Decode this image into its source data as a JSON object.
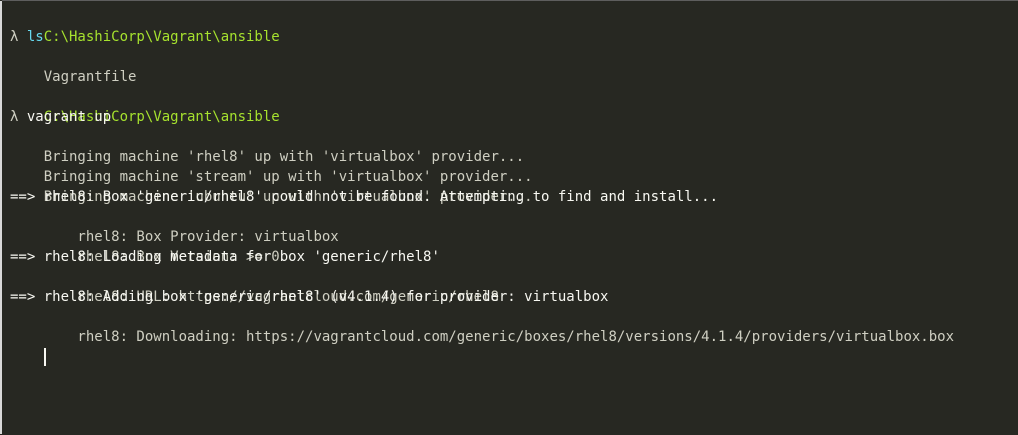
{
  "window": {
    "lines": [
      {
        "kind": "path",
        "text": "C:\\HashiCorp\\Vagrant\\ansible"
      },
      {
        "kind": "prompt",
        "symbol": "λ",
        "text": "ls"
      },
      {
        "kind": "out",
        "text": "Vagrantfile"
      },
      {
        "kind": "blank",
        "text": ""
      },
      {
        "kind": "path",
        "text": "C:\\HashiCorp\\Vagrant\\ansible"
      },
      {
        "kind": "prompt",
        "symbol": "λ",
        "text": "vagrant up"
      },
      {
        "kind": "out",
        "text": "Bringing machine 'rhel8' up with 'virtualbox' provider..."
      },
      {
        "kind": "out",
        "text": "Bringing machine 'stream' up with 'virtualbox' provider..."
      },
      {
        "kind": "out",
        "text": "Bringing machine 'ubuntu' up with 'virtualbox' provider..."
      },
      {
        "kind": "arrow",
        "marker": "==> ",
        "text": "rhel8: Box 'generic/rhel8' could not be found. Attempting to find and install..."
      },
      {
        "kind": "sub",
        "text": "    rhel8: Box Provider: virtualbox"
      },
      {
        "kind": "sub",
        "text": "    rhel8: Box Version: >= 0"
      },
      {
        "kind": "arrow",
        "marker": "==> ",
        "text": "rhel8: Loading metadata for box 'generic/rhel8'"
      },
      {
        "kind": "sub",
        "text": "    rhel8: URL: https://vagrantcloud.com/generic/rhel8"
      },
      {
        "kind": "arrow",
        "marker": "==> ",
        "text": "rhel8: Adding box 'generic/rhel8' (v4.1.4) for provider: virtualbox"
      },
      {
        "kind": "sub",
        "text": "    rhel8: Downloading: https://vagrantcloud.com/generic/boxes/rhel8/versions/4.1.4/providers/virtualbox.box"
      }
    ]
  },
  "colors": {
    "background": "#272822",
    "path": "#a6e22e",
    "command_ls": "#66d9ef",
    "text": "#cfcfc2",
    "bright": "#f8f8f2"
  }
}
